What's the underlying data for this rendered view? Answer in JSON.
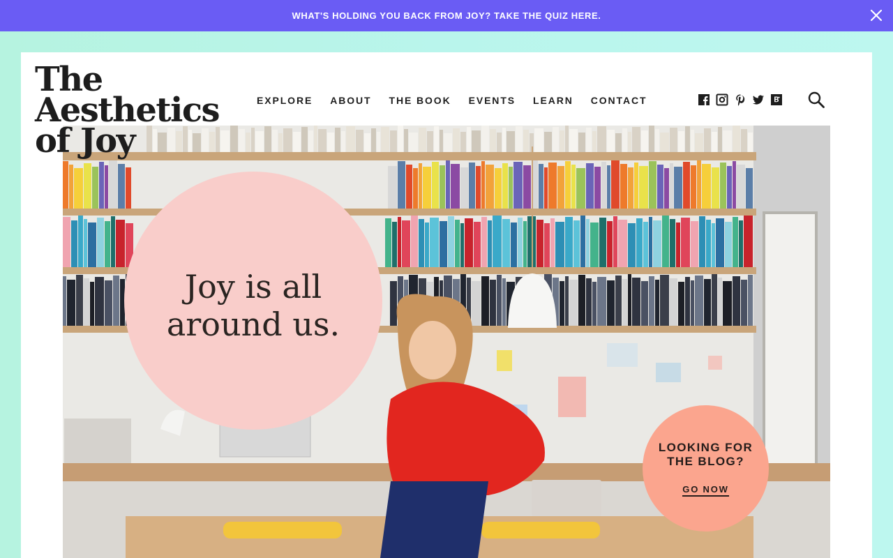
{
  "promo": {
    "text": "WHAT'S HOLDING YOU BACK FROM JOY? TAKE THE QUIZ HERE.",
    "close_icon": "close-icon",
    "background": "#6a5cf4"
  },
  "logo": {
    "line1": "The",
    "line2": "Aesthetics",
    "line3": "of Joy"
  },
  "nav": {
    "items": [
      {
        "label": "EXPLORE"
      },
      {
        "label": "ABOUT"
      },
      {
        "label": "THE BOOK"
      },
      {
        "label": "EVENTS"
      },
      {
        "label": "LEARN"
      },
      {
        "label": "CONTACT"
      }
    ]
  },
  "social": {
    "icons": [
      "facebook-icon",
      "instagram-icon",
      "pinterest-icon",
      "twitter-icon",
      "bloglovin-icon"
    ]
  },
  "search": {
    "icon": "search-icon"
  },
  "hero": {
    "headline": "Joy is all around us.",
    "circle_color": "#f9cdca",
    "image": "woman-in-red-blouse-in-front-of-rainbow-bookshelf"
  },
  "blog_callout": {
    "question": "LOOKING FOR THE BLOG?",
    "cta": "GO NOW",
    "circle_color": "#fba58e"
  },
  "colors": {
    "page_background": "#b9f5ec",
    "text": "#1d1d1d"
  }
}
